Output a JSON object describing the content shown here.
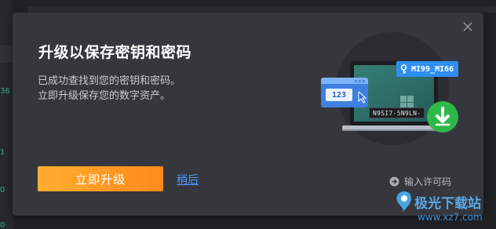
{
  "background": {
    "side_numbers": [
      "36",
      "1",
      "0",
      "0"
    ]
  },
  "dialog": {
    "title": "升级以保存密钥和密码",
    "description_lines": [
      "已成功查找到您的密钥和密码。",
      "立即升级保存您的数字资产。"
    ],
    "upgrade_button": "立即升级",
    "later_link": "稍后",
    "license_link": "输入许可码",
    "close_icon": "close-icon"
  },
  "illustration": {
    "key_badge": "MI99_MI66",
    "password_card": "123",
    "product_key": "N9SI7-5N9LN-",
    "icons": [
      "key-icon",
      "cursor-icon",
      "download-icon",
      "windows-logo-icon"
    ]
  },
  "watermark": {
    "name": "极光下载站",
    "url": "www.xz7.com"
  },
  "colors": {
    "accent_orange": "#ff9a24",
    "link_blue": "#4a9bff",
    "dialog_bg": "#35373d",
    "badge_blue": "#2f8ff0",
    "download_green": "#2fb84a"
  }
}
